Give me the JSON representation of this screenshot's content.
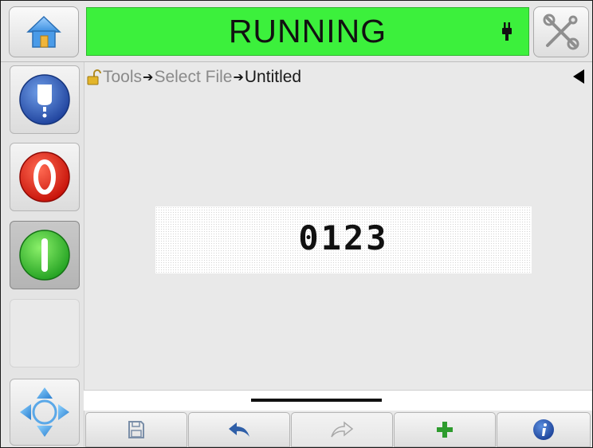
{
  "header": {
    "status": "RUNNING",
    "status_color": "#3cf03c",
    "icons": [
      "home-icon",
      "plug-icon",
      "tools-icon"
    ]
  },
  "sidebar": {
    "buttons": [
      {
        "name": "ink-system-button",
        "icon": "ink-bottle-icon",
        "color": "#1f4fb0"
      },
      {
        "name": "stop-button",
        "icon": "stop-icon",
        "color": "#e01a10"
      },
      {
        "name": "start-button",
        "icon": "start-icon",
        "color": "#2fbf2f",
        "pressed": true
      }
    ],
    "nav_icon": "navigation-arrows-icon"
  },
  "breadcrumb": {
    "lock_icon": "unlocked-padlock-icon",
    "items": [
      "Tools",
      "Select File"
    ],
    "current": "Untitled"
  },
  "preview": {
    "text": "0123"
  },
  "toolbar": {
    "buttons": [
      {
        "icon": "save-icon",
        "enabled": true
      },
      {
        "icon": "undo-icon",
        "enabled": true
      },
      {
        "icon": "redo-icon",
        "enabled": false
      },
      {
        "icon": "add-icon",
        "enabled": true
      },
      {
        "icon": "info-icon",
        "enabled": true
      }
    ]
  }
}
